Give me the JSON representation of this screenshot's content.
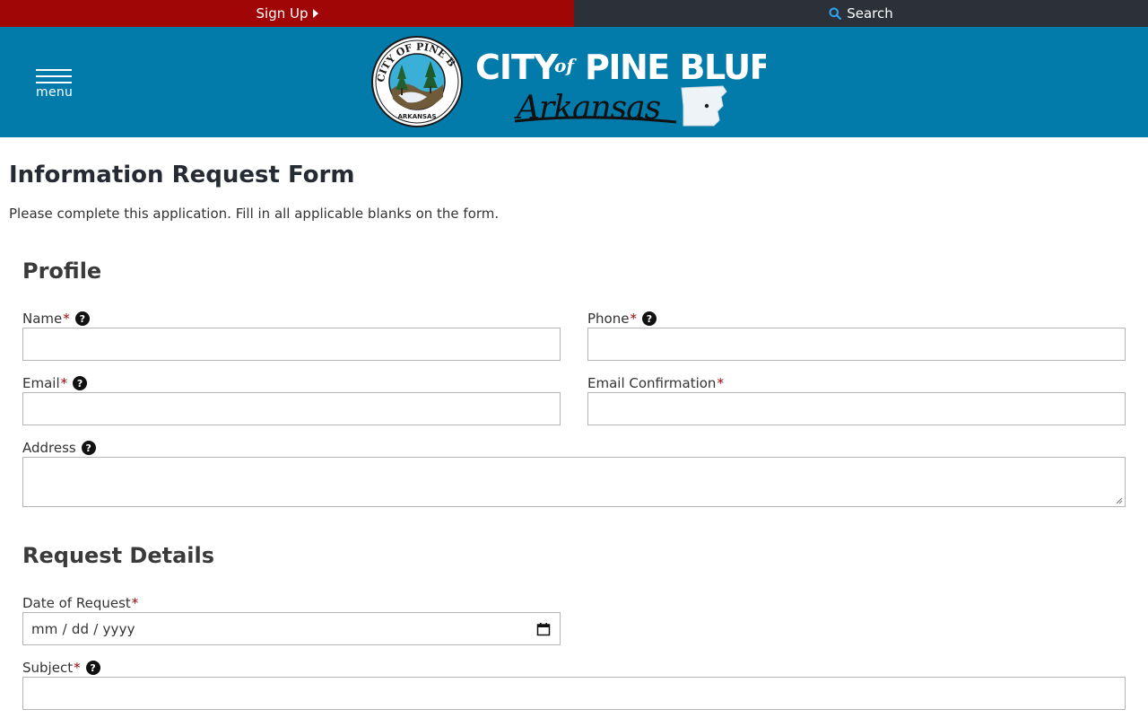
{
  "topbar": {
    "signup_label": "Sign Up",
    "search_label": "Search",
    "signup_color": "#a10606",
    "search_bg": "#2b3039",
    "search_icon": "search-icon"
  },
  "header": {
    "menu_label": "menu",
    "bg_color": "#027bab",
    "logo": {
      "title_city": "CITY",
      "title_of": "of",
      "title_name": "PINE BLUFF",
      "subtitle": "Arkansas",
      "seal_top": "CITY OF PINE BLUFF",
      "seal_bottom": "ARKANSAS"
    }
  },
  "page": {
    "title": "Information Request Form",
    "intro": "Please complete this application. Fill in all applicable blanks on the form."
  },
  "sections": {
    "profile": {
      "title": "Profile",
      "name_label": "Name",
      "phone_label": "Phone",
      "email_label": "Email",
      "email_confirm_label": "Email Confirmation",
      "address_label": "Address",
      "required_mark": "*",
      "help_mark": "?"
    },
    "request": {
      "title": "Request Details",
      "date_label": "Date of Request",
      "date_placeholder": "mm / dd / yyyy",
      "subject_label": "Subject",
      "required_mark": "*",
      "help_mark": "?"
    }
  }
}
